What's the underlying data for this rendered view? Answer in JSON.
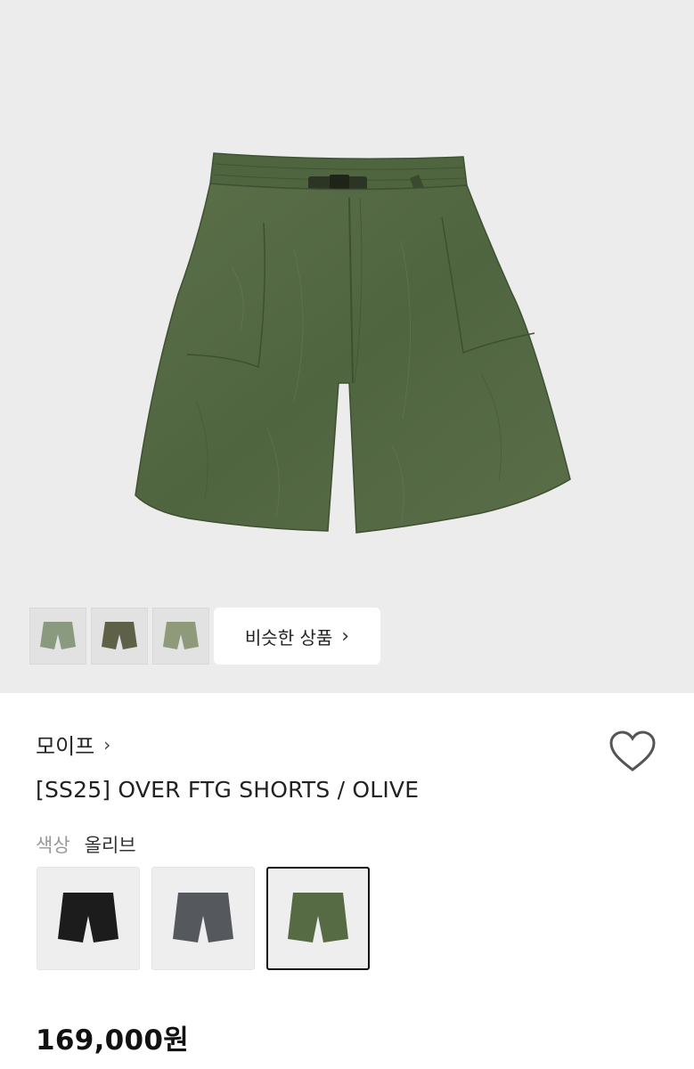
{
  "gallery": {
    "main_image": "olive-shorts-product-photo",
    "thumbnails": [
      {
        "name": "thumb-1",
        "tone": "#8a9a7e"
      },
      {
        "name": "thumb-2",
        "tone": "#5e6147"
      },
      {
        "name": "thumb-3",
        "tone": "#8e9a7a"
      }
    ],
    "similar_button_label": "비슷한 상품",
    "similar_button_icon": "chevron-right-icon"
  },
  "product": {
    "brand": "모이프",
    "brand_icon": "chevron-right-icon",
    "wishlist_icon": "heart-icon",
    "title": "[SS25] OVER FTG SHORTS / OLIVE",
    "color_label": "색상",
    "color_value": "올리브",
    "color_options": [
      {
        "name": "black",
        "tone": "#1c1c1c",
        "selected": false
      },
      {
        "name": "charcoal",
        "tone": "#55595d",
        "selected": false
      },
      {
        "name": "olive",
        "tone": "#566a44",
        "selected": true
      }
    ],
    "price": "169,000원"
  },
  "colors": {
    "hero_bg": "#ececec",
    "olive": "#546b45",
    "text": "#222222",
    "muted": "#999999"
  }
}
